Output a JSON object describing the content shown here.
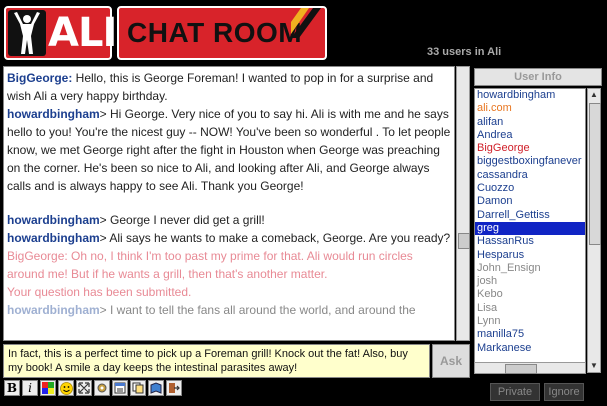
{
  "header": {
    "logo_word": "ALI",
    "chat_room_title": "CHAT ROOM",
    "users_count_text": "33 users in Ali"
  },
  "messages": [
    {
      "nick": "BigGeorge:",
      "text": " Hello, this is George Foreman! I wanted to pop in for a surprise and wish Ali a very happy birthday."
    },
    {
      "nick": "howardbingham",
      "text": "> Hi George.  Very nice of you to say hi.  Ali is with me and he says hello to you!  You're the nicest guy -- NOW!  You've been so wonderful .  To let people know, we met George right after the fight in Houston when George was preaching on the corner.  He's been so nice to Ali, and looking after Ali, and George always calls and is always happy to see Ali.  Thank you George!"
    },
    {
      "nick": "howardbingham",
      "text": "> George I never did get a grill!"
    },
    {
      "nick": "howardbingham",
      "text": "> Ali says he wants to make a comeback, George.  Are you ready?"
    },
    {
      "nick": "BigGeorge:",
      "text": " Oh no, I think I'm too past my prime for that. Ali would run circles around me! But if he wants a grill, then that's another matter."
    },
    {
      "nick": "",
      "text": "Your question has been submitted."
    },
    {
      "nick": "howardbingham",
      "text": "> I want to tell the fans all around the world, and around the"
    }
  ],
  "input": {
    "value": "In fact, this is a perfect time to pick up a Foreman grill! Knock out the fat! Also, buy my book! A smile a day keeps the intestinal parasites away!"
  },
  "buttons": {
    "ask": "Ask",
    "user_info": "User Info",
    "private": "Private",
    "ignore": "Ignore"
  },
  "toolbar": {
    "bold": "B",
    "italic": "i",
    "icons": [
      "bold-icon",
      "italic-icon",
      "color-palette-icon",
      "smiley-icon",
      "expand-icon",
      "settings-icon",
      "notepad-icon",
      "copy-icon",
      "book-icon",
      "exit-icon"
    ]
  },
  "users": [
    "howardbingham",
    "ali.com",
    "alifan",
    "Andrea",
    "BigGeorge",
    "biggestboxingfanever",
    "cassandra",
    "Cuozzo",
    "Damon",
    "Darrell_Gettiss",
    "greg",
    "HassanRus",
    "Hesparus",
    "John_Ensign",
    "josh",
    "Kebo",
    "Lisa",
    "Lynn",
    "manilla75",
    "Markanese"
  ],
  "colors": {
    "nick_blue": "#1c3f8f",
    "logo_red": "#d8232a",
    "selection": "#1024c4",
    "user_orange": "#e87722",
    "user_red": "#d0202a",
    "message_pink": "#e88a95"
  }
}
